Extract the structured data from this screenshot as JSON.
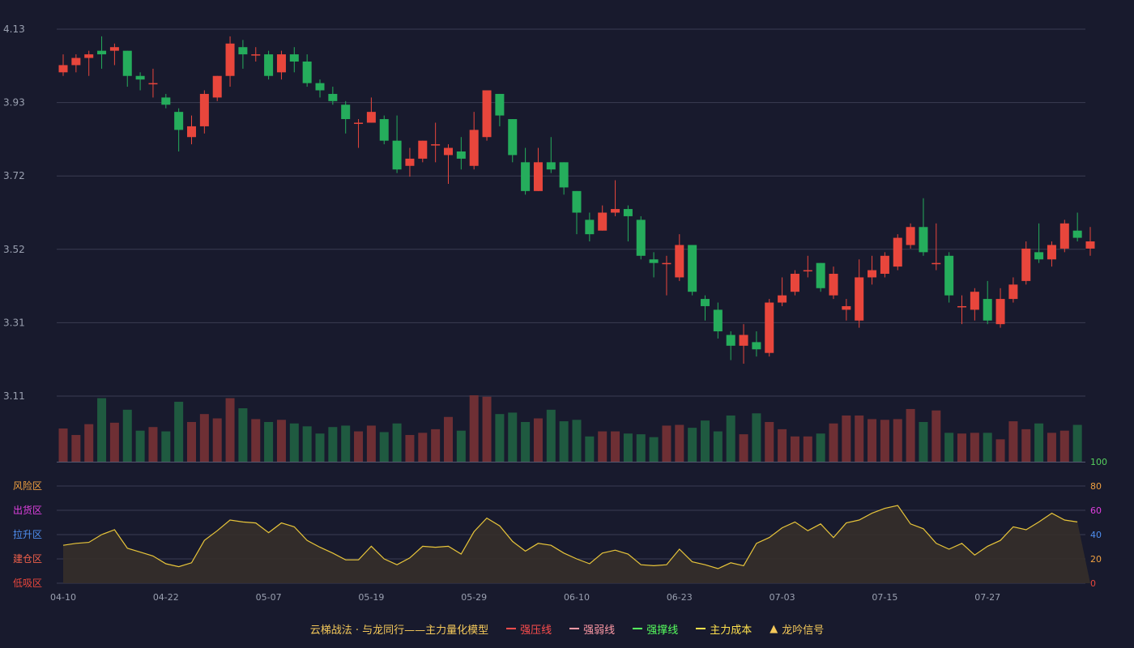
{
  "colors": {
    "background": "#181a2d",
    "grid": "#3a3c52",
    "up": "#e8463c",
    "down": "#25ad5c",
    "vol_up": "#6e2f34",
    "vol_down": "#1f5a40",
    "axis_text": "#9aa0b0",
    "line": "#e8c53a",
    "area": "#352f2a",
    "legend_text": "#f5c95a"
  },
  "chart_data": [
    {
      "type": "candlestick",
      "yaxis_ticks": [
        "4.13",
        "3.93",
        "3.72",
        "3.52",
        "3.31",
        "3.11"
      ],
      "ylim": [
        3.11,
        4.13
      ],
      "xaxis_ticks": [
        "04-10",
        "04-22",
        "05-07",
        "05-19",
        "05-29",
        "06-10",
        "06-23",
        "07-03",
        "07-15",
        "07-27"
      ],
      "xaxis_tick_index": [
        0,
        8,
        16,
        24,
        32,
        40,
        48,
        56,
        64,
        72
      ],
      "ohlc": [
        [
          4.01,
          4.03,
          4.06,
          4.0
        ],
        [
          4.03,
          4.05,
          4.06,
          4.01
        ],
        [
          4.05,
          4.06,
          4.07,
          4.0
        ],
        [
          4.07,
          4.06,
          4.11,
          4.02
        ],
        [
          4.07,
          4.08,
          4.09,
          4.03
        ],
        [
          4.07,
          4.0,
          4.07,
          3.97
        ],
        [
          4.0,
          3.99,
          4.01,
          3.96
        ],
        [
          3.98,
          3.98,
          4.02,
          3.94
        ],
        [
          3.94,
          3.92,
          3.95,
          3.91
        ],
        [
          3.9,
          3.85,
          3.91,
          3.79
        ],
        [
          3.83,
          3.86,
          3.89,
          3.81
        ],
        [
          3.86,
          3.95,
          3.96,
          3.84
        ],
        [
          3.94,
          4.0,
          4.0,
          3.93
        ],
        [
          4.0,
          4.09,
          4.11,
          3.97
        ],
        [
          4.08,
          4.06,
          4.1,
          4.02
        ],
        [
          4.06,
          4.06,
          4.08,
          4.04
        ],
        [
          4.06,
          4.0,
          4.07,
          3.99
        ],
        [
          4.01,
          4.06,
          4.07,
          3.99
        ],
        [
          4.06,
          4.04,
          4.08,
          4.01
        ],
        [
          4.04,
          3.98,
          4.06,
          3.97
        ],
        [
          3.98,
          3.96,
          3.99,
          3.94
        ],
        [
          3.95,
          3.93,
          3.97,
          3.92
        ],
        [
          3.92,
          3.88,
          3.93,
          3.84
        ],
        [
          3.87,
          3.87,
          3.88,
          3.8
        ],
        [
          3.87,
          3.9,
          3.94,
          3.87
        ],
        [
          3.88,
          3.82,
          3.89,
          3.81
        ],
        [
          3.82,
          3.74,
          3.89,
          3.73
        ],
        [
          3.75,
          3.77,
          3.8,
          3.72
        ],
        [
          3.77,
          3.82,
          3.82,
          3.76
        ],
        [
          3.81,
          3.81,
          3.87,
          3.76
        ],
        [
          3.78,
          3.8,
          3.81,
          3.7
        ],
        [
          3.79,
          3.77,
          3.83,
          3.74
        ],
        [
          3.75,
          3.85,
          3.9,
          3.74
        ],
        [
          3.83,
          3.96,
          3.96,
          3.82
        ],
        [
          3.95,
          3.89,
          3.95,
          3.86
        ],
        [
          3.88,
          3.78,
          3.88,
          3.76
        ],
        [
          3.76,
          3.68,
          3.8,
          3.67
        ],
        [
          3.68,
          3.76,
          3.8,
          3.68
        ],
        [
          3.76,
          3.74,
          3.83,
          3.73
        ],
        [
          3.76,
          3.69,
          3.76,
          3.67
        ],
        [
          3.68,
          3.62,
          3.68,
          3.56
        ],
        [
          3.6,
          3.56,
          3.62,
          3.54
        ],
        [
          3.57,
          3.62,
          3.64,
          3.57
        ],
        [
          3.62,
          3.63,
          3.71,
          3.61
        ],
        [
          3.63,
          3.61,
          3.64,
          3.54
        ],
        [
          3.6,
          3.5,
          3.61,
          3.49
        ],
        [
          3.49,
          3.48,
          3.51,
          3.44
        ],
        [
          3.48,
          3.48,
          3.5,
          3.39
        ],
        [
          3.44,
          3.53,
          3.56,
          3.43
        ],
        [
          3.53,
          3.4,
          3.53,
          3.39
        ],
        [
          3.38,
          3.36,
          3.39,
          3.32
        ],
        [
          3.35,
          3.29,
          3.37,
          3.27
        ],
        [
          3.28,
          3.25,
          3.29,
          3.21
        ],
        [
          3.25,
          3.28,
          3.31,
          3.2
        ],
        [
          3.26,
          3.24,
          3.29,
          3.22
        ],
        [
          3.23,
          3.37,
          3.38,
          3.22
        ],
        [
          3.37,
          3.39,
          3.44,
          3.36
        ],
        [
          3.4,
          3.45,
          3.46,
          3.39
        ],
        [
          3.46,
          3.46,
          3.5,
          3.44
        ],
        [
          3.48,
          3.41,
          3.48,
          3.4
        ],
        [
          3.39,
          3.45,
          3.47,
          3.38
        ],
        [
          3.35,
          3.36,
          3.38,
          3.32
        ],
        [
          3.32,
          3.44,
          3.49,
          3.3
        ],
        [
          3.44,
          3.46,
          3.5,
          3.42
        ],
        [
          3.45,
          3.5,
          3.51,
          3.44
        ],
        [
          3.47,
          3.55,
          3.56,
          3.46
        ],
        [
          3.53,
          3.58,
          3.59,
          3.52
        ],
        [
          3.58,
          3.51,
          3.66,
          3.5
        ],
        [
          3.48,
          3.48,
          3.59,
          3.46
        ],
        [
          3.5,
          3.39,
          3.51,
          3.37
        ],
        [
          3.36,
          3.36,
          3.39,
          3.31
        ],
        [
          3.35,
          3.4,
          3.41,
          3.32
        ],
        [
          3.38,
          3.32,
          3.43,
          3.31
        ],
        [
          3.31,
          3.38,
          3.41,
          3.3
        ],
        [
          3.38,
          3.42,
          3.44,
          3.37
        ],
        [
          3.43,
          3.52,
          3.54,
          3.42
        ],
        [
          3.51,
          3.49,
          3.59,
          3.48
        ],
        [
          3.49,
          3.53,
          3.54,
          3.47
        ],
        [
          3.52,
          3.59,
          3.6,
          3.51
        ],
        [
          3.57,
          3.55,
          3.62,
          3.54
        ],
        [
          3.52,
          3.54,
          3.58,
          3.5
        ]
      ],
      "volume": [
        46,
        37,
        52,
        88,
        54,
        72,
        43,
        48,
        42,
        83,
        55,
        66,
        60,
        88,
        74,
        59,
        55,
        58,
        53,
        49,
        39,
        48,
        50,
        42,
        50,
        41,
        53,
        37,
        40,
        45,
        62,
        43,
        92,
        90,
        66,
        68,
        55,
        60,
        72,
        56,
        58,
        35,
        42,
        42,
        39,
        38,
        34,
        50,
        51,
        47,
        57,
        42,
        64,
        38,
        67,
        55,
        45,
        35,
        35,
        39,
        53,
        64,
        64,
        59,
        58,
        59,
        73,
        55,
        71,
        40,
        39,
        40,
        40,
        31,
        56,
        45,
        53,
        40,
        43,
        51
      ],
      "volume_max": 92
    },
    {
      "type": "area",
      "yaxis_ticks": [
        "100",
        "80",
        "60",
        "40",
        "20",
        "0"
      ],
      "ylim": [
        0,
        100
      ],
      "zone_labels": [
        "风险区",
        "出货区",
        "拉升区",
        "建仓区",
        "低吸区"
      ],
      "values": [
        39,
        41,
        42,
        50,
        55,
        36,
        32,
        28,
        20,
        17,
        21,
        44,
        54,
        65,
        63,
        62,
        52,
        62,
        58,
        44,
        37,
        31,
        24,
        24,
        38,
        25,
        19,
        26,
        38,
        37,
        38,
        30,
        53,
        67,
        59,
        43,
        33,
        41,
        39,
        31,
        25,
        20,
        31,
        34,
        30,
        19,
        18,
        19,
        35,
        22,
        19,
        15,
        21,
        18,
        41,
        47,
        57,
        63,
        54,
        61,
        47,
        62,
        65,
        72,
        77,
        80,
        61,
        56,
        41,
        35,
        41,
        29,
        38,
        44,
        58,
        55,
        63,
        72,
        65,
        63
      ]
    }
  ],
  "legend": {
    "title": "云梯战法 · 与龙同行——主力量化模型",
    "items": [
      {
        "label": "强压线",
        "color": "#ff4d4d",
        "style": "solid"
      },
      {
        "label": "强弱线",
        "color": "#ff9aa6",
        "style": "dashed"
      },
      {
        "label": "强撑线",
        "color": "#56ff5e",
        "style": "solid"
      },
      {
        "label": "主力成本",
        "color": "#ffe14d",
        "style": "dashed"
      },
      {
        "label": "龙吟信号",
        "color": "#f5c95a",
        "style": "triangle",
        "icon": "▲"
      }
    ]
  }
}
